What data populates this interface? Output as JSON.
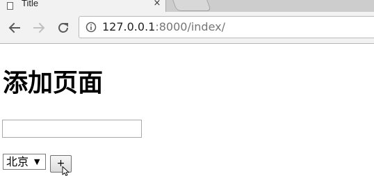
{
  "browser": {
    "tab_title": "Title",
    "tab_close": "×",
    "url_host": "127.0.0.1",
    "url_rest": ":8000/index/",
    "icons": {
      "back": "back-arrow-icon",
      "forward": "forward-arrow-icon",
      "reload": "reload-icon",
      "info": "info-icon",
      "page": "page-icon"
    }
  },
  "page": {
    "heading": "添加页面",
    "text_input": {
      "value": "",
      "placeholder": ""
    },
    "city_select": {
      "selected": "北京",
      "arrow": "▼"
    },
    "add_button_label": "+"
  }
}
